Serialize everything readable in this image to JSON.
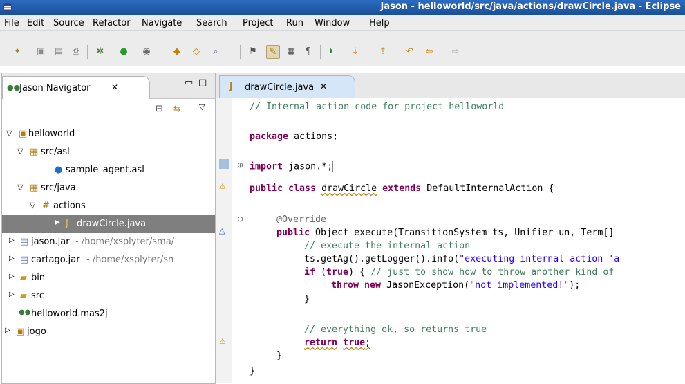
{
  "window": {
    "title": "Jason - helloworld/src/java/actions/drawCircle.java - Eclipse"
  },
  "menu": [
    "File",
    "Edit",
    "Source",
    "Refactor",
    "Navigate",
    "Search",
    "Project",
    "Run",
    "Window",
    "Help"
  ],
  "colors": {
    "titlebar": "#1f5aa8",
    "keyword": "#7f0055",
    "comment": "#3f7f5f",
    "string": "#2a00ff",
    "selection": "#7f7f7f"
  },
  "navigator": {
    "tab_label": "Jason Navigator",
    "tree": [
      {
        "label": "helloworld",
        "icon": "project-icon",
        "expanded": true
      },
      {
        "label": "src/asl",
        "icon": "source-folder-icon",
        "expanded": true
      },
      {
        "label": "sample_agent.asl",
        "icon": "agent-icon"
      },
      {
        "label": "src/java",
        "icon": "source-folder-icon",
        "expanded": true
      },
      {
        "label": "actions",
        "icon": "package-icon",
        "expanded": true
      },
      {
        "label": "drawCircle.java",
        "icon": "java-file-icon",
        "selected": true
      },
      {
        "label": "jason.jar",
        "suffix": " - /home/xsplyter/sma/",
        "icon": "jar-icon"
      },
      {
        "label": "cartago.jar",
        "suffix": " - /home/xsplyter/sn",
        "icon": "jar-icon"
      },
      {
        "label": "bin",
        "icon": "folder-icon"
      },
      {
        "label": "src",
        "icon": "folder-icon"
      },
      {
        "label": "helloworld.mas2j",
        "icon": "mas2j-icon"
      },
      {
        "label": "jogo",
        "icon": "project-icon"
      }
    ]
  },
  "editor": {
    "tab_label": "drawCircle.java",
    "lines": {
      "l1": "// Internal action code for project helloworld",
      "l2a": "package",
      "l2b": " actions;",
      "l3a": "import",
      "l3b": " jason.*;",
      "l4a": "public class",
      "l4b": "drawCircle",
      "l4c": "extends",
      "l4d": " DefaultInternalAction {",
      "l5": "@Override",
      "l6a": "public",
      "l6b": " Object execute(TransitionSystem ts, Unifier un, Term[]",
      "l7": "// execute the internal action",
      "l8a": "ts.getAg().getLogger().info(",
      "l8b": "\"executing internal action 'a",
      "l9a": "if",
      "l9b": " (",
      "l9c": "true",
      "l9d": ") { ",
      "l9e": "// just to show how to throw another kind of",
      "l10a": "throw new",
      "l10b": " JasonException(",
      "l10c": "\"not implemented!\"",
      "l10d": ");",
      "l11": "}",
      "l12": "// everything ok, so returns true",
      "l13a": "return",
      "l13b": "true",
      "l13c": ";",
      "l14": "}",
      "l15": "}"
    }
  }
}
